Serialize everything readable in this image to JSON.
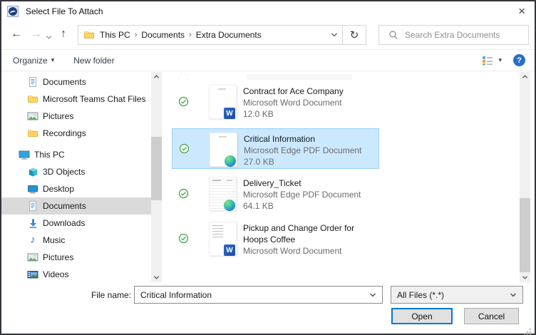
{
  "window": {
    "title": "Select File To Attach"
  },
  "icons": {
    "back": "←",
    "forward": "→",
    "up": "↑",
    "refresh": "↻",
    "dropdown": "▾",
    "close": "×",
    "help": "?",
    "music_note": "♪",
    "word_letter": "W"
  },
  "nav": {
    "breadcrumb": [
      "This PC",
      "Documents",
      "Extra Documents"
    ],
    "breadcrumb_separator": "›",
    "search_placeholder": "Search Extra Documents"
  },
  "toolbar": {
    "organize_label": "Organize",
    "new_folder_label": "New folder"
  },
  "sidebar": {
    "items": [
      {
        "label": "Documents",
        "icon": "document",
        "indent": 2,
        "selected": false
      },
      {
        "label": "Microsoft Teams Chat Files",
        "icon": "folder",
        "indent": 2,
        "selected": false
      },
      {
        "label": "Pictures",
        "icon": "picture",
        "indent": 2,
        "selected": false
      },
      {
        "label": "Recordings",
        "icon": "folder",
        "indent": 2,
        "selected": false
      },
      {
        "label": "This PC",
        "icon": "computer",
        "indent": 1,
        "selected": false
      },
      {
        "label": "3D Objects",
        "icon": "cube",
        "indent": 2,
        "selected": false
      },
      {
        "label": "Desktop",
        "icon": "desktop",
        "indent": 2,
        "selected": false
      },
      {
        "label": "Documents",
        "icon": "document",
        "indent": 2,
        "selected": true
      },
      {
        "label": "Downloads",
        "icon": "download",
        "indent": 2,
        "selected": false
      },
      {
        "label": "Music",
        "icon": "music",
        "indent": 2,
        "selected": false
      },
      {
        "label": "Pictures",
        "icon": "picture",
        "indent": 2,
        "selected": false
      },
      {
        "label": "Videos",
        "icon": "video",
        "indent": 2,
        "selected": false
      }
    ]
  },
  "files": [
    {
      "name": "Contract for Ace Company",
      "type": "Microsoft Word Document",
      "size": "12.0 KB",
      "app_icon": "word",
      "thumb": "blank",
      "selected": false
    },
    {
      "name": "Critical Information",
      "type": "Microsoft Edge PDF Document",
      "size": "27.0 KB",
      "app_icon": "edge",
      "thumb": "blank",
      "selected": true
    },
    {
      "name": "Delivery_Ticket",
      "type": "Microsoft Edge PDF Document",
      "size": "64.1 KB",
      "app_icon": "edge",
      "thumb": "table",
      "selected": false
    },
    {
      "name": "Pickup and Change Order for Hoops Coffee",
      "type": "Microsoft Word Document",
      "size": "",
      "app_icon": "word",
      "thumb": "text",
      "selected": false
    }
  ],
  "footer": {
    "file_name_label": "File name:",
    "file_name_value": "Critical Information",
    "file_type_value": "All Files (*.*)",
    "open_label": "Open",
    "cancel_label": "Cancel"
  },
  "colors": {
    "selection_bg": "#cce8ff",
    "selection_border": "#99d1ff",
    "accent": "#0078d7",
    "sync_green": "#3aa33a"
  }
}
